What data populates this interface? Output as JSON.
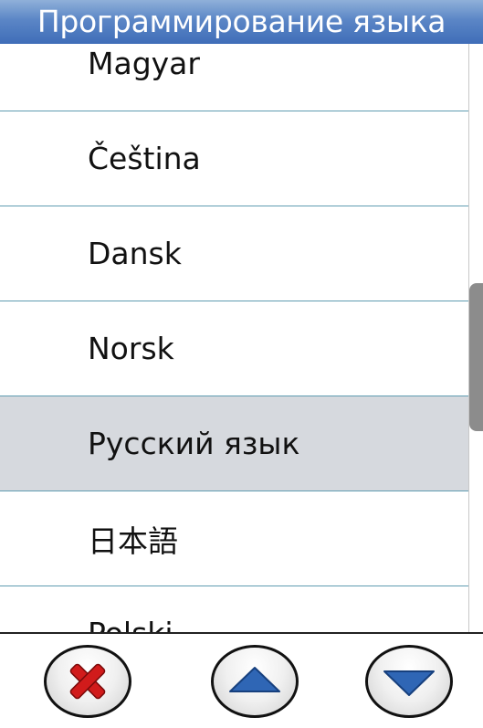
{
  "header": {
    "title": "Программирование языка"
  },
  "languages": [
    {
      "label": "Magyar"
    },
    {
      "label": "Čeština"
    },
    {
      "label": "Dansk"
    },
    {
      "label": "Norsk"
    },
    {
      "label": "Русский язык",
      "selected": true
    },
    {
      "label": "日本語"
    },
    {
      "label": "Polski"
    }
  ],
  "buttons": {
    "cancel_icon": "close-icon",
    "up_icon": "arrow-up-icon",
    "down_icon": "arrow-down-icon"
  },
  "colors": {
    "header_bg": "#4f7bc0",
    "selected_row_bg": "#d6d9de",
    "row_divider": "#5f9cb1",
    "arrow_blue": "#2f66b5",
    "cancel_red": "#d11b1b"
  }
}
